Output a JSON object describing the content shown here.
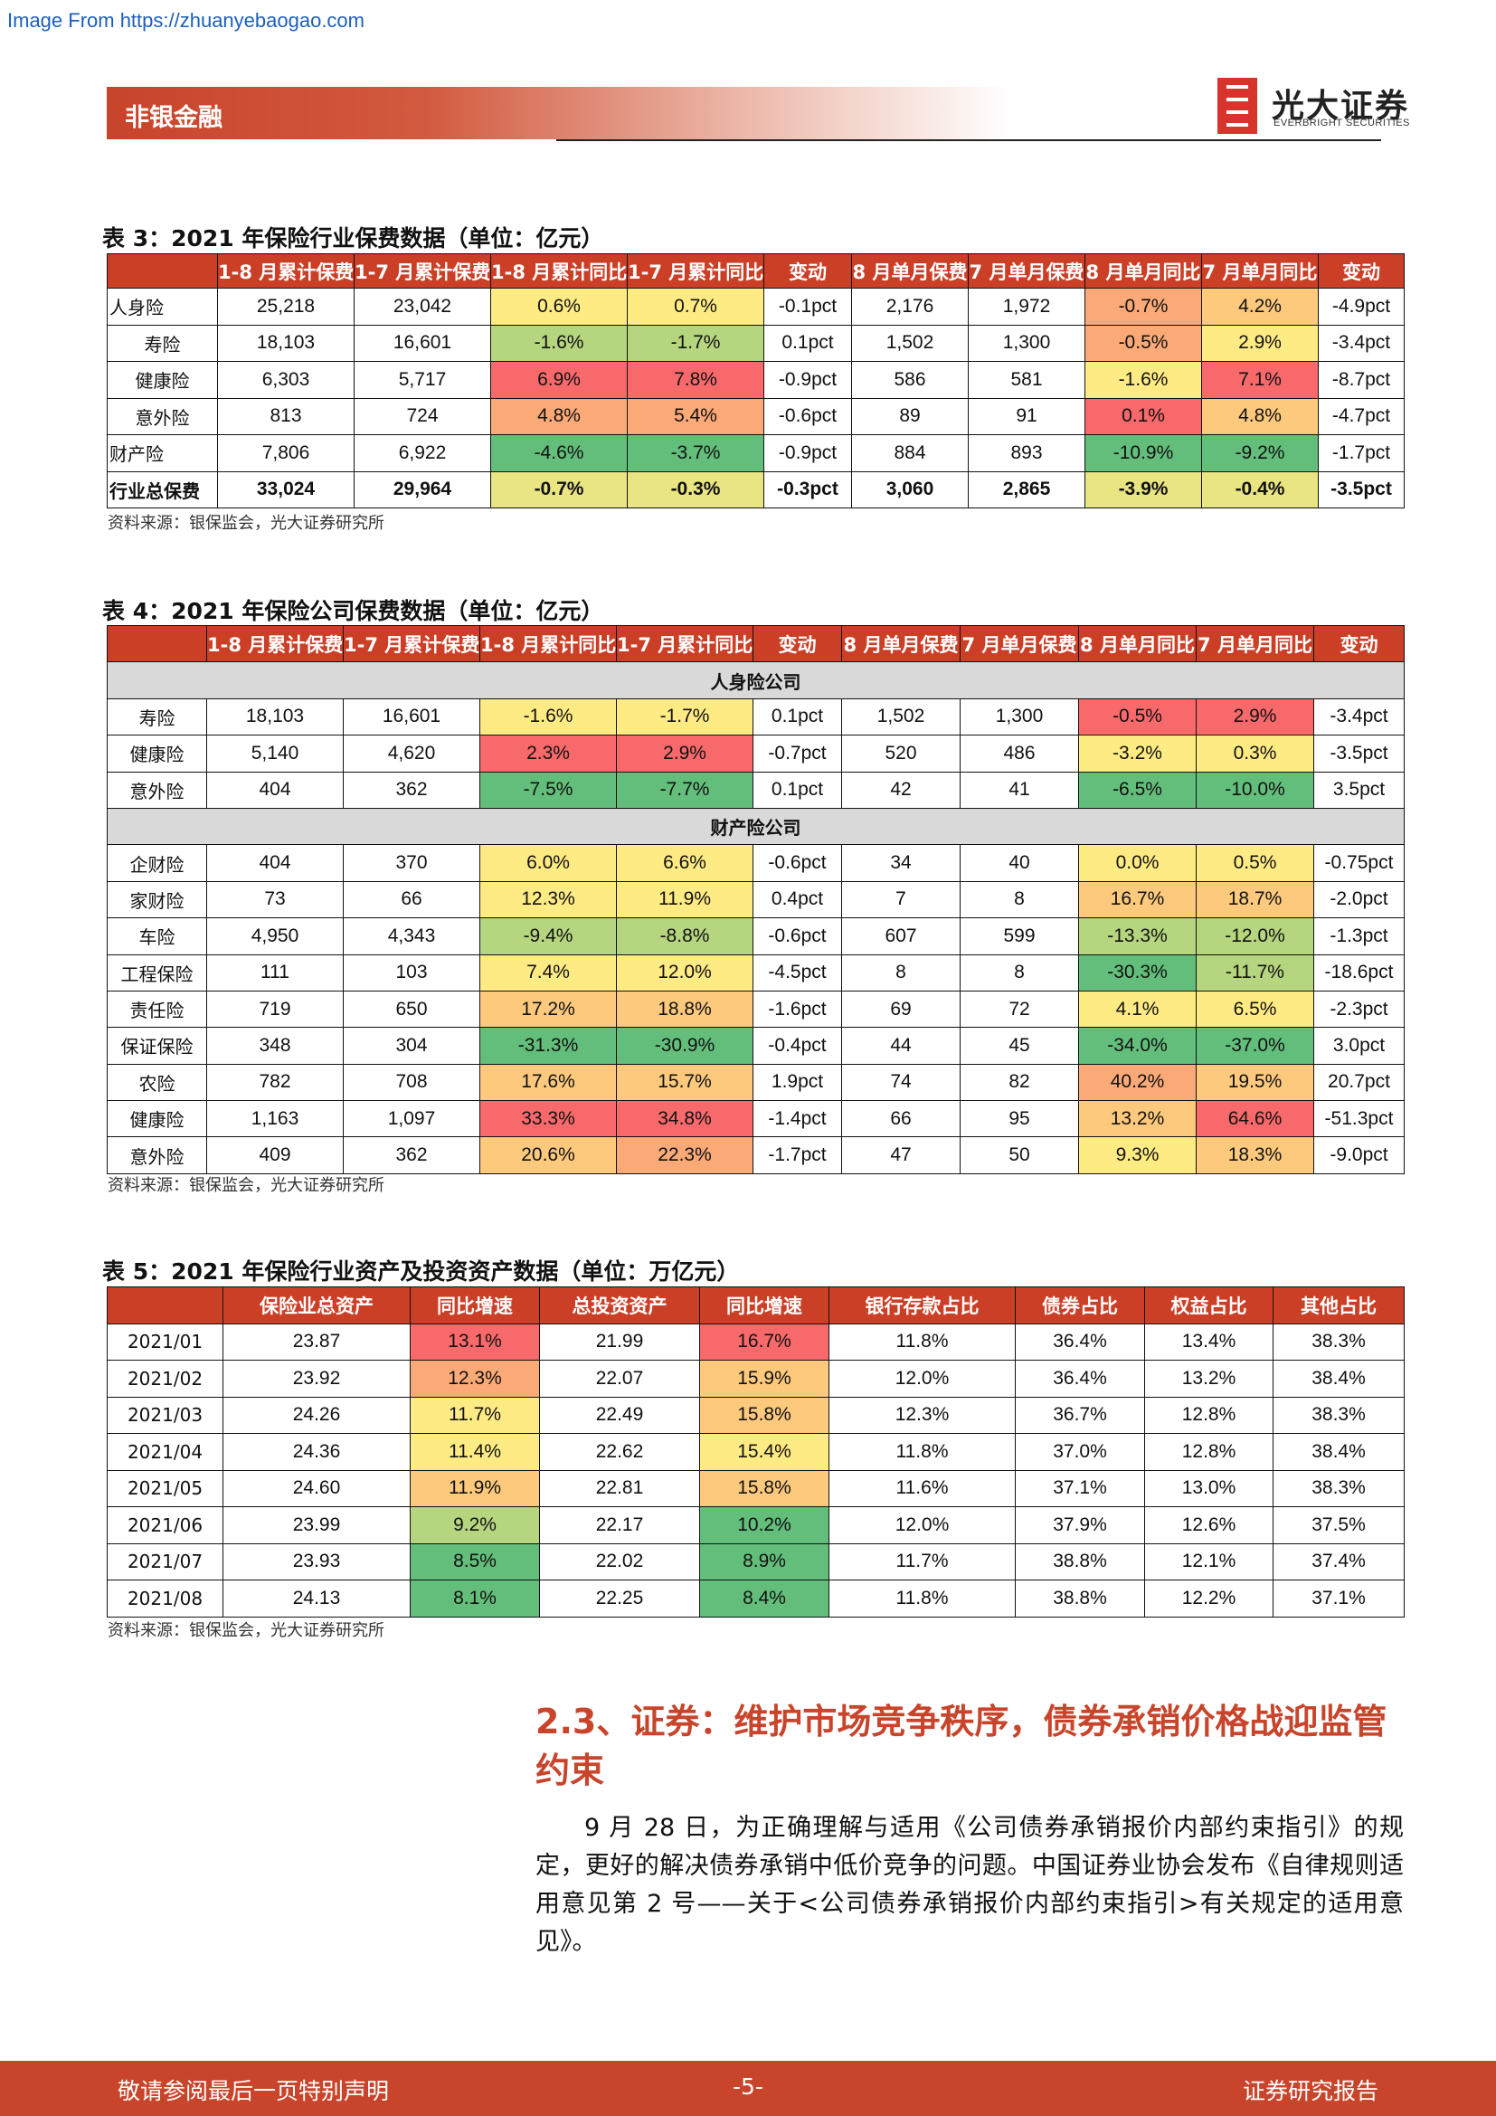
{
  "source_url": "Image From https://zhuanyebaogao.com",
  "header": {
    "section": "非银金融",
    "logo_cn": "光大证券",
    "logo_en": "EVERBRIGHT SECURITIES"
  },
  "colors": {
    "accent": "#c8442a",
    "red": "#f8696b",
    "orange": "#fbaa77",
    "lightorange": "#fdc97d",
    "yellow": "#ffeb84",
    "khaki": "#e9e583",
    "lightgreen": "#b6d57f",
    "green": "#63be7b"
  },
  "table3": {
    "title": "表 3：2021 年保险行业保费数据（单位：亿元）",
    "headers": [
      "",
      "1-8 月累计保费",
      "1-7 月累计保费",
      "1-8 月累计同比",
      "1-7 月累计同比",
      "变动",
      "8 月单月保费",
      "7 月单月保费",
      "8 月单月同比",
      "7 月单月同比",
      "变动"
    ],
    "rows": [
      {
        "cells": [
          "人身险",
          "25,218",
          "23,042",
          "0.6%",
          "0.7%",
          "-0.1pct",
          "2,176",
          "1,972",
          "-0.7%",
          "4.2%",
          "-4.9pct"
        ],
        "heat": [
          "",
          "",
          "",
          "yellow",
          "yellow",
          "",
          "",
          "",
          "orange",
          "lightorange",
          ""
        ]
      },
      {
        "cells": [
          "寿险",
          "18,103",
          "16,601",
          "-1.6%",
          "-1.7%",
          "0.1pct",
          "1,502",
          "1,300",
          "-0.5%",
          "2.9%",
          "-3.4pct"
        ],
        "heat": [
          "",
          "",
          "",
          "lightgreen",
          "lightgreen",
          "",
          "",
          "",
          "orange",
          "yellow",
          ""
        ]
      },
      {
        "cells": [
          "健康险",
          "6,303",
          "5,717",
          "6.9%",
          "7.8%",
          "-0.9pct",
          "586",
          "581",
          "-1.6%",
          "7.1%",
          "-8.7pct"
        ],
        "heat": [
          "",
          "",
          "",
          "red",
          "red",
          "",
          "",
          "",
          "yellow",
          "red",
          ""
        ]
      },
      {
        "cells": [
          "意外险",
          "813",
          "724",
          "4.8%",
          "5.4%",
          "-0.6pct",
          "89",
          "91",
          "0.1%",
          "4.8%",
          "-4.7pct"
        ],
        "heat": [
          "",
          "",
          "",
          "orange",
          "orange",
          "",
          "",
          "",
          "red",
          "lightorange",
          ""
        ]
      },
      {
        "cells": [
          "财产险",
          "7,806",
          "6,922",
          "-4.6%",
          "-3.7%",
          "-0.9pct",
          "884",
          "893",
          "-10.9%",
          "-9.2%",
          "-1.7pct"
        ],
        "heat": [
          "",
          "",
          "",
          "green",
          "green",
          "",
          "",
          "",
          "green",
          "green",
          ""
        ]
      },
      {
        "cells": [
          "行业总保费",
          "33,024",
          "29,964",
          "-0.7%",
          "-0.3%",
          "-0.3pct",
          "3,060",
          "2,865",
          "-3.9%",
          "-0.4%",
          "-3.5pct"
        ],
        "heat": [
          "",
          "",
          "",
          "khaki",
          "khaki",
          "",
          "",
          "",
          "khaki",
          "khaki",
          ""
        ]
      }
    ],
    "source": "资料来源：银保监会，光大证券研究所"
  },
  "table4": {
    "title": "表 4：2021 年保险公司保费数据（单位：亿元）",
    "headers": [
      "",
      "1-8 月累计保费",
      "1-7 月累计保费",
      "1-8 月累计同比",
      "1-7 月累计同比",
      "变动",
      "8 月单月保费",
      "7 月单月保费",
      "8 月单月同比",
      "7 月单月同比",
      "变动"
    ],
    "sections": [
      {
        "name": "人身险公司",
        "rows": [
          {
            "cells": [
              "寿险",
              "18,103",
              "16,601",
              "-1.6%",
              "-1.7%",
              "0.1pct",
              "1,502",
              "1,300",
              "-0.5%",
              "2.9%",
              "-3.4pct"
            ],
            "heat": [
              "",
              "",
              "",
              "yellow",
              "yellow",
              "",
              "",
              "",
              "red",
              "red",
              ""
            ]
          },
          {
            "cells": [
              "健康险",
              "5,140",
              "4,620",
              "2.3%",
              "2.9%",
              "-0.7pct",
              "520",
              "486",
              "-3.2%",
              "0.3%",
              "-3.5pct"
            ],
            "heat": [
              "",
              "",
              "",
              "red",
              "red",
              "",
              "",
              "",
              "yellow",
              "yellow",
              ""
            ]
          },
          {
            "cells": [
              "意外险",
              "404",
              "362",
              "-7.5%",
              "-7.7%",
              "0.1pct",
              "42",
              "41",
              "-6.5%",
              "-10.0%",
              "3.5pct"
            ],
            "heat": [
              "",
              "",
              "",
              "green",
              "green",
              "",
              "",
              "",
              "green",
              "green",
              ""
            ]
          }
        ]
      },
      {
        "name": "财产险公司",
        "rows": [
          {
            "cells": [
              "企财险",
              "404",
              "370",
              "6.0%",
              "6.6%",
              "-0.6pct",
              "34",
              "40",
              "0.0%",
              "0.5%",
              "-0.75pct"
            ],
            "heat": [
              "",
              "",
              "",
              "yellow",
              "yellow",
              "",
              "",
              "",
              "yellow",
              "yellow",
              ""
            ]
          },
          {
            "cells": [
              "家财险",
              "73",
              "66",
              "12.3%",
              "11.9%",
              "0.4pct",
              "7",
              "8",
              "16.7%",
              "18.7%",
              "-2.0pct"
            ],
            "heat": [
              "",
              "",
              "",
              "yellow",
              "yellow",
              "",
              "",
              "",
              "lightorange",
              "lightorange",
              ""
            ]
          },
          {
            "cells": [
              "车险",
              "4,950",
              "4,343",
              "-9.4%",
              "-8.8%",
              "-0.6pct",
              "607",
              "599",
              "-13.3%",
              "-12.0%",
              "-1.3pct"
            ],
            "heat": [
              "",
              "",
              "",
              "lightgreen",
              "lightgreen",
              "",
              "",
              "",
              "lightgreen",
              "lightgreen",
              ""
            ]
          },
          {
            "cells": [
              "工程保险",
              "111",
              "103",
              "7.4%",
              "12.0%",
              "-4.5pct",
              "8",
              "8",
              "-30.3%",
              "-11.7%",
              "-18.6pct"
            ],
            "heat": [
              "",
              "",
              "",
              "yellow",
              "yellow",
              "",
              "",
              "",
              "green",
              "lightgreen",
              ""
            ]
          },
          {
            "cells": [
              "责任险",
              "719",
              "650",
              "17.2%",
              "18.8%",
              "-1.6pct",
              "69",
              "72",
              "4.1%",
              "6.5%",
              "-2.3pct"
            ],
            "heat": [
              "",
              "",
              "",
              "lightorange",
              "lightorange",
              "",
              "",
              "",
              "yellow",
              "yellow",
              ""
            ]
          },
          {
            "cells": [
              "保证保险",
              "348",
              "304",
              "-31.3%",
              "-30.9%",
              "-0.4pct",
              "44",
              "45",
              "-34.0%",
              "-37.0%",
              "3.0pct"
            ],
            "heat": [
              "",
              "",
              "",
              "green",
              "green",
              "",
              "",
              "",
              "green",
              "green",
              ""
            ]
          },
          {
            "cells": [
              "农险",
              "782",
              "708",
              "17.6%",
              "15.7%",
              "1.9pct",
              "74",
              "82",
              "40.2%",
              "19.5%",
              "20.7pct"
            ],
            "heat": [
              "",
              "",
              "",
              "lightorange",
              "lightorange",
              "",
              "",
              "",
              "orange",
              "lightorange",
              ""
            ]
          },
          {
            "cells": [
              "健康险",
              "1,163",
              "1,097",
              "33.3%",
              "34.8%",
              "-1.4pct",
              "66",
              "95",
              "13.2%",
              "64.6%",
              "-51.3pct"
            ],
            "heat": [
              "",
              "",
              "",
              "red",
              "red",
              "",
              "",
              "",
              "lightorange",
              "red",
              ""
            ]
          },
          {
            "cells": [
              "意外险",
              "409",
              "362",
              "20.6%",
              "22.3%",
              "-1.7pct",
              "47",
              "50",
              "9.3%",
              "18.3%",
              "-9.0pct"
            ],
            "heat": [
              "",
              "",
              "",
              "lightorange",
              "orange",
              "",
              "",
              "",
              "yellow",
              "lightorange",
              ""
            ]
          }
        ]
      }
    ],
    "source": "资料来源：银保监会，光大证券研究所"
  },
  "table5": {
    "title": "表 5：2021 年保险行业资产及投资资产数据（单位：万亿元）",
    "headers": [
      "",
      "保险业总资产",
      "同比增速",
      "总投资资产",
      "同比增速",
      "银行存款占比",
      "债券占比",
      "权益占比",
      "其他占比"
    ],
    "rows": [
      {
        "cells": [
          "2021/01",
          "23.87",
          "13.1%",
          "21.99",
          "16.7%",
          "11.8%",
          "36.4%",
          "13.4%",
          "38.3%"
        ],
        "heat": [
          "",
          "",
          "red",
          "",
          "red",
          "",
          "",
          "",
          ""
        ]
      },
      {
        "cells": [
          "2021/02",
          "23.92",
          "12.3%",
          "22.07",
          "15.9%",
          "12.0%",
          "36.4%",
          "13.2%",
          "38.4%"
        ],
        "heat": [
          "",
          "",
          "orange",
          "",
          "lightorange",
          "",
          "",
          "",
          ""
        ]
      },
      {
        "cells": [
          "2021/03",
          "24.26",
          "11.7%",
          "22.49",
          "15.8%",
          "12.3%",
          "36.7%",
          "12.8%",
          "38.3%"
        ],
        "heat": [
          "",
          "",
          "yellow",
          "",
          "lightorange",
          "",
          "",
          "",
          ""
        ]
      },
      {
        "cells": [
          "2021/04",
          "24.36",
          "11.4%",
          "22.62",
          "15.4%",
          "11.8%",
          "37.0%",
          "12.8%",
          "38.4%"
        ],
        "heat": [
          "",
          "",
          "yellow",
          "",
          "yellow",
          "",
          "",
          "",
          ""
        ]
      },
      {
        "cells": [
          "2021/05",
          "24.60",
          "11.9%",
          "22.81",
          "15.8%",
          "11.6%",
          "37.1%",
          "13.0%",
          "38.3%"
        ],
        "heat": [
          "",
          "",
          "lightorange",
          "",
          "lightorange",
          "",
          "",
          "",
          ""
        ]
      },
      {
        "cells": [
          "2021/06",
          "23.99",
          "9.2%",
          "22.17",
          "10.2%",
          "12.0%",
          "37.9%",
          "12.6%",
          "37.5%"
        ],
        "heat": [
          "",
          "",
          "lightgreen",
          "",
          "green",
          "",
          "",
          "",
          ""
        ]
      },
      {
        "cells": [
          "2021/07",
          "23.93",
          "8.5%",
          "22.02",
          "8.9%",
          "11.7%",
          "38.8%",
          "12.1%",
          "37.4%"
        ],
        "heat": [
          "",
          "",
          "green",
          "",
          "green",
          "",
          "",
          "",
          ""
        ]
      },
      {
        "cells": [
          "2021/08",
          "24.13",
          "8.1%",
          "22.25",
          "8.4%",
          "11.8%",
          "38.8%",
          "12.2%",
          "37.1%"
        ],
        "heat": [
          "",
          "",
          "green",
          "",
          "green",
          "",
          "",
          "",
          ""
        ]
      }
    ],
    "source": "资料来源：银保监会，光大证券研究所"
  },
  "section_heading": "2.3、证券：维护市场竞争秩序，债券承销价格战迎监管约束",
  "body_paragraph": "9 月 28 日，为正确理解与适用《公司债券承销报价内部约束指引》的规定，更好的解决债券承销中低价竞争的问题。中国证券业协会发布《自律规则适用意见第 2 号——关于<公司债券承销报价内部约束指引>有关规定的适用意见》。",
  "footer": {
    "left": "敬请参阅最后一页特别声明",
    "center": "-5-",
    "right": "证券研究报告"
  }
}
